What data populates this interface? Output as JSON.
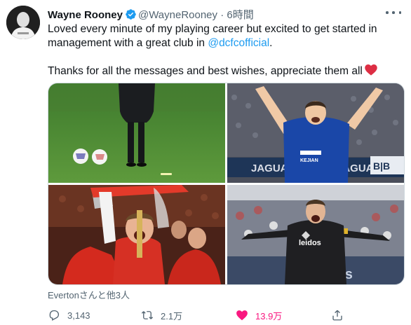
{
  "tweet": {
    "author_name": "Wayne Rooney",
    "author_handle": "@WayneRooney",
    "separator": "·",
    "time": "6時間",
    "text_line1_before": "Loved every minute of my playing career but excited to get started in management with a great club in ",
    "mention": "@dcfcofficial",
    "text_line1_after": ".",
    "text_line2": "Thanks for all the messages and best wishes, appreciate them all",
    "likers": "Evertonさんと他3人",
    "reply_count": "3,143",
    "retweet_count": "2.1万",
    "like_count": "13.9万",
    "photo_labels": {
      "jaguar_left": "JAGUAR",
      "jaguar_right": "JAGUAR",
      "bb_sign": "B|B",
      "kejian": "KEJIAN",
      "leidos": "leidos",
      "los": "los"
    }
  },
  "colors": {
    "link": "#1d9bf0",
    "like": "#f91880",
    "muted": "#536471",
    "verified": "#1d9bf0"
  },
  "icons": [
    "verified-badge-icon",
    "more-options-icon",
    "heart-emoji-icon",
    "reply-icon",
    "retweet-icon",
    "like-icon",
    "share-icon"
  ]
}
